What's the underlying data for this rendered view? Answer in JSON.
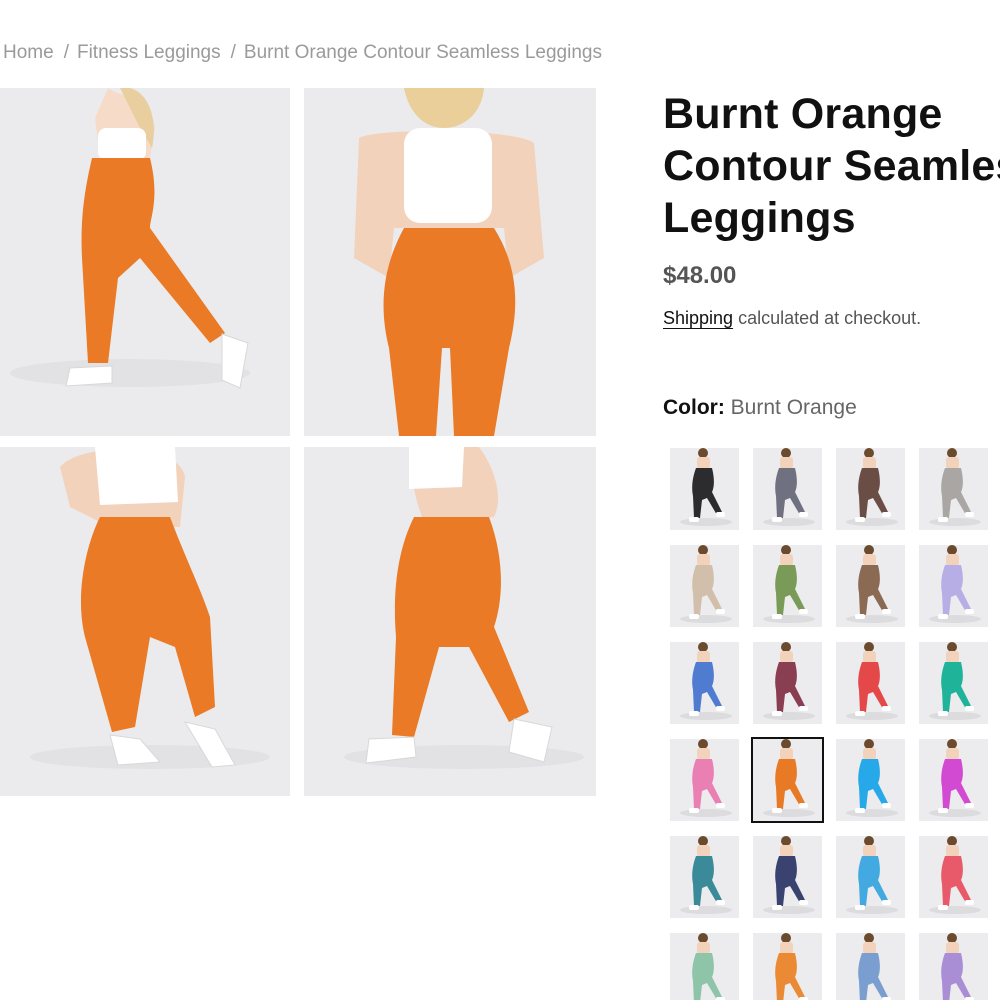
{
  "breadcrumb": {
    "home": "Home",
    "category": "Fitness Leggings",
    "current": "Burnt Orange Contour Seamless Leggings",
    "separator": "/"
  },
  "product": {
    "title_line1": "Burnt Orange",
    "title_line2": "Contour Seamless",
    "title_line3": "Leggings",
    "price": "$48.00",
    "shipping_link": "Shipping",
    "shipping_text": " calculated at checkout.",
    "color_label": "Color:",
    "color_value": "Burnt Orange",
    "legging_color": "#ea7a25"
  },
  "gallery": [
    {
      "name": "side-stride",
      "legging": "#ea7a25"
    },
    {
      "name": "back-view",
      "legging": "#ea7a25"
    },
    {
      "name": "front-pose",
      "legging": "#ea7a25"
    },
    {
      "name": "back-walk",
      "legging": "#ea7a25"
    }
  ],
  "swatches": [
    {
      "color": "#2c2c2e",
      "selected": false
    },
    {
      "color": "#6f7180",
      "selected": false
    },
    {
      "color": "#6a4e45",
      "selected": false
    },
    {
      "color": "#a9a6a4",
      "selected": false
    },
    {
      "color": "#d2bfab",
      "selected": false
    },
    {
      "color": "#7a9a58",
      "selected": false
    },
    {
      "color": "#8a6a52",
      "selected": false
    },
    {
      "color": "#b8aee6",
      "selected": false
    },
    {
      "color": "#4f7cd1",
      "selected": false
    },
    {
      "color": "#8a3e52",
      "selected": false
    },
    {
      "color": "#e54848",
      "selected": false
    },
    {
      "color": "#1fb39a",
      "selected": false
    },
    {
      "color": "#ea7fb4",
      "selected": false
    },
    {
      "color": "#e87a25",
      "selected": true
    },
    {
      "color": "#27a8e8",
      "selected": false
    },
    {
      "color": "#d24ad2",
      "selected": false
    },
    {
      "color": "#3a8a9a",
      "selected": false
    },
    {
      "color": "#3a4270",
      "selected": false
    },
    {
      "color": "#42aae0",
      "selected": false
    },
    {
      "color": "#e85a6a",
      "selected": false
    },
    {
      "color": "#8ec4a8",
      "selected": false
    },
    {
      "color": "#ea8a35",
      "selected": false
    },
    {
      "color": "#7a9ed0",
      "selected": false
    },
    {
      "color": "#a98ed6",
      "selected": false
    }
  ]
}
